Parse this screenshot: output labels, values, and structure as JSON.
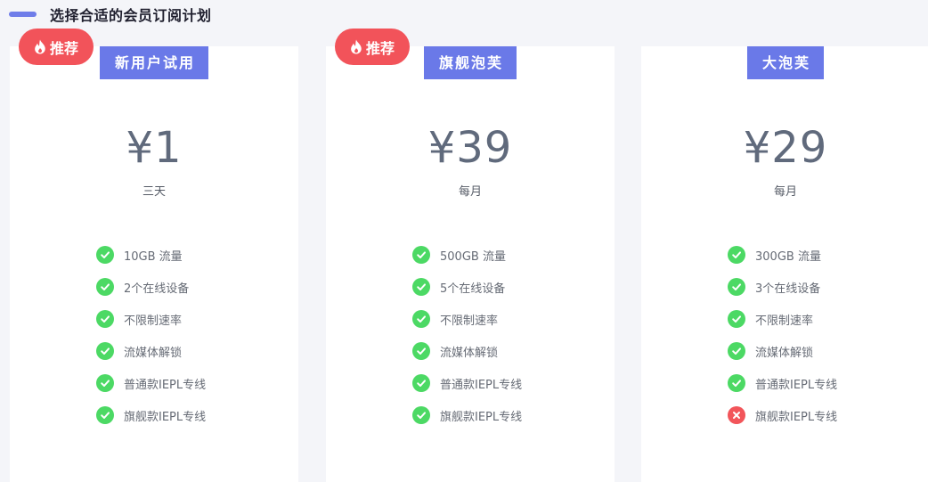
{
  "header": {
    "title": "选择合适的会员订阅计划"
  },
  "badge": {
    "label": "推荐",
    "icon": "flame-icon"
  },
  "colors": {
    "accent": "#6a79e8",
    "badge": "#f2535a",
    "check": "#4cd964",
    "cross": "#f2555a"
  },
  "plans": [
    {
      "name": "新用户试用",
      "price": "¥1",
      "period": "三天",
      "recommended": true,
      "features": [
        {
          "label": "10GB 流量",
          "included": true
        },
        {
          "label": "2个在线设备",
          "included": true
        },
        {
          "label": "不限制速率",
          "included": true
        },
        {
          "label": "流媒体解锁",
          "included": true
        },
        {
          "label": "普通款IEPL专线",
          "included": true
        },
        {
          "label": "旗舰款IEPL专线",
          "included": true
        }
      ]
    },
    {
      "name": "旗舰泡芙",
      "price": "¥39",
      "period": "每月",
      "recommended": true,
      "features": [
        {
          "label": "500GB 流量",
          "included": true
        },
        {
          "label": "5个在线设备",
          "included": true
        },
        {
          "label": "不限制速率",
          "included": true
        },
        {
          "label": "流媒体解锁",
          "included": true
        },
        {
          "label": "普通款IEPL专线",
          "included": true
        },
        {
          "label": "旗舰款IEPL专线",
          "included": true
        }
      ]
    },
    {
      "name": "大泡芙",
      "price": "¥29",
      "period": "每月",
      "recommended": false,
      "features": [
        {
          "label": "300GB 流量",
          "included": true
        },
        {
          "label": "3个在线设备",
          "included": true
        },
        {
          "label": "不限制速率",
          "included": true
        },
        {
          "label": "流媒体解锁",
          "included": true
        },
        {
          "label": "普通款IEPL专线",
          "included": true
        },
        {
          "label": "旗舰款IEPL专线",
          "included": false
        }
      ]
    }
  ]
}
